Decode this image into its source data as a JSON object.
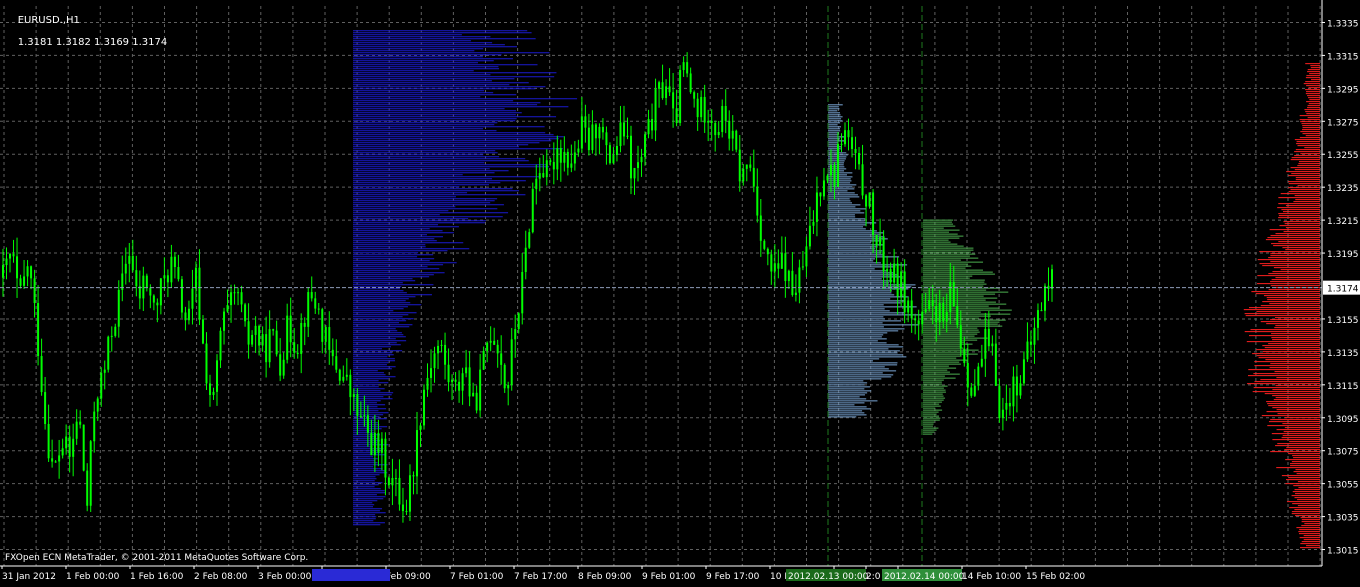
{
  "header": {
    "symbol": "EURUSD.,H1",
    "ohlc": "1.3181 1.3182 1.3169 1.3174"
  },
  "footer": {
    "copyright": "FXOpen ECN MetaTrader, © 2001-2011 MetaQuotes Software Corp."
  },
  "colors": {
    "background": "#000000",
    "grid": "#606060",
    "candles": "#00ff00",
    "profile_1": "#1a1acd",
    "profile_2": "#7aa6d6",
    "profile_3": "#4caf50",
    "profile_full": "#ff2020",
    "current_price_line": "#8e9bb8",
    "vline": "#1e7a1e",
    "axis_text": "#ffffff"
  },
  "chart_data": {
    "type": "candlestick",
    "symbol": "EURUSD.",
    "timeframe": "H1",
    "current_price": 1.3174,
    "last_bar": {
      "open": 1.3181,
      "high": 1.3182,
      "low": 1.3169,
      "close": 1.3174
    },
    "ylim": [
      1.3005,
      1.3345
    ],
    "y_ticks": [
      "1.3335",
      "1.3315",
      "1.3295",
      "1.3275",
      "1.3255",
      "1.3235",
      "1.3215",
      "1.3195",
      "1.3174",
      "1.3155",
      "1.3135",
      "1.3115",
      "1.3095",
      "1.3075",
      "1.3055",
      "1.3035",
      "1.3015"
    ],
    "x_ticks": [
      "31 Jan 2012",
      "1 Feb 00:00",
      "1 Feb 16:00",
      "2 Feb 08:00",
      "3 Feb 00:00",
      "",
      "Feb 09:00",
      "7 Feb 01:00",
      "7 Feb 17:00",
      "8 Feb 09:00",
      "9 Feb 01:00",
      "9 Feb 17:00",
      "10 F",
      "",
      "2:0",
      "",
      "14 Feb 10:00",
      "15 Feb 02:00"
    ],
    "highlighted_x_labels": [
      "2012.02.13 00:00",
      "2012.02.14 00:00"
    ],
    "price_path": [
      1.318,
      1.3195,
      1.3165,
      1.319,
      1.315,
      1.3095,
      1.306,
      1.308,
      1.307,
      1.31,
      1.304,
      1.311,
      1.312,
      1.315,
      1.317,
      1.32,
      1.3165,
      1.318,
      1.316,
      1.3175,
      1.319,
      1.317,
      1.315,
      1.318,
      1.313,
      1.31,
      1.315,
      1.316,
      1.317,
      1.314,
      1.315,
      1.3135,
      1.3145,
      1.313,
      1.315,
      1.314,
      1.316,
      1.317,
      1.315,
      1.313,
      1.3125,
      1.3115,
      1.31,
      1.309,
      1.308,
      1.3075,
      1.306,
      1.305,
      1.304,
      1.307,
      1.311,
      1.313,
      1.314,
      1.312,
      1.311,
      1.313,
      1.31,
      1.312,
      1.315,
      1.314,
      1.311,
      1.315,
      1.318,
      1.323,
      1.325,
      1.324,
      1.326,
      1.3255,
      1.325,
      1.327,
      1.326,
      1.328,
      1.325,
      1.326,
      1.327,
      1.324,
      1.325,
      1.327,
      1.329,
      1.33,
      1.327,
      1.331,
      1.329,
      1.328,
      1.3285,
      1.327,
      1.328,
      1.326,
      1.324,
      1.325,
      1.322,
      1.319,
      1.318,
      1.319,
      1.317,
      1.318,
      1.32,
      1.323,
      1.325,
      1.324,
      1.327,
      1.326,
      1.324,
      1.323,
      1.32,
      1.319,
      1.318,
      1.3175,
      1.316,
      1.315,
      1.3155,
      1.3165,
      1.315,
      1.317,
      1.3145,
      1.312,
      1.3115,
      1.314,
      1.313,
      1.3095,
      1.311,
      1.312,
      1.313,
      1.315,
      1.317,
      1.318
    ],
    "volume_profiles": [
      {
        "range": [
          1.303,
          1.333
        ],
        "peak_price": 1.3283,
        "color": "blue"
      },
      {
        "range": [
          1.3095,
          1.3285
        ],
        "peak_price": 1.316,
        "color": "lightblue"
      },
      {
        "range": [
          1.3085,
          1.3215
        ],
        "peak_price": 1.3165,
        "color": "green"
      },
      {
        "range": [
          1.3015,
          1.331
        ],
        "peak_price": 1.3145,
        "color": "red"
      }
    ],
    "grid": true
  }
}
